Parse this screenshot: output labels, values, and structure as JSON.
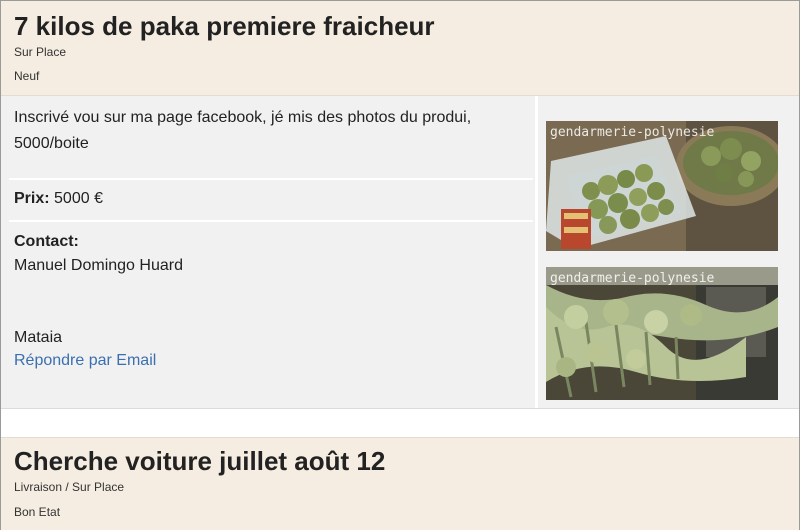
{
  "listings": [
    {
      "title": "7 kilos de paka premiere fraicheur",
      "delivery": "Sur Place",
      "condition": "Neuf",
      "description": "Inscrivé vou sur ma page facebook, jé mis des photos du produi, 5000/boite",
      "price_label": "Prix:",
      "price_value": "5000 €",
      "contact_label": "Contact:",
      "contact_name": "Manuel Domingo Huard",
      "location": "Mataia",
      "reply_link": "Répondre par Email",
      "photos": [
        {
          "watermark": "gendarmerie-polynesie",
          "subject": "cannabis buds in plastic container"
        },
        {
          "watermark": "gendarmerie-polynesie",
          "subject": "cannabis plants drying"
        }
      ]
    },
    {
      "title": "Cherche voiture juillet août 12",
      "delivery": "Livraison / Sur Place",
      "condition": "Bon Etat"
    }
  ],
  "colors": {
    "header_bg": "#f5ede2",
    "body_bg": "#f1f1f1",
    "link": "#3a6fb0"
  }
}
